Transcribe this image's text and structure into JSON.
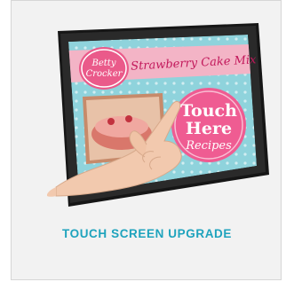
{
  "product": {
    "caption": "TOUCH SCREEN UPGRADE"
  },
  "screen": {
    "brand_line1": "Betty",
    "brand_line2": "Crocker",
    "headline": "Strawberry Cake Mix",
    "touch_line1": "Touch",
    "touch_line2": "Here",
    "touch_line3": "Recipes"
  },
  "colors": {
    "caption": "#1ea3bd",
    "screen_bg": "#8fd3dc",
    "banner": "#f3b4c6",
    "circle": "#ef5c92",
    "brand_badge": "#ea5a8a"
  },
  "icons": [
    "hand-pointer-icon"
  ]
}
